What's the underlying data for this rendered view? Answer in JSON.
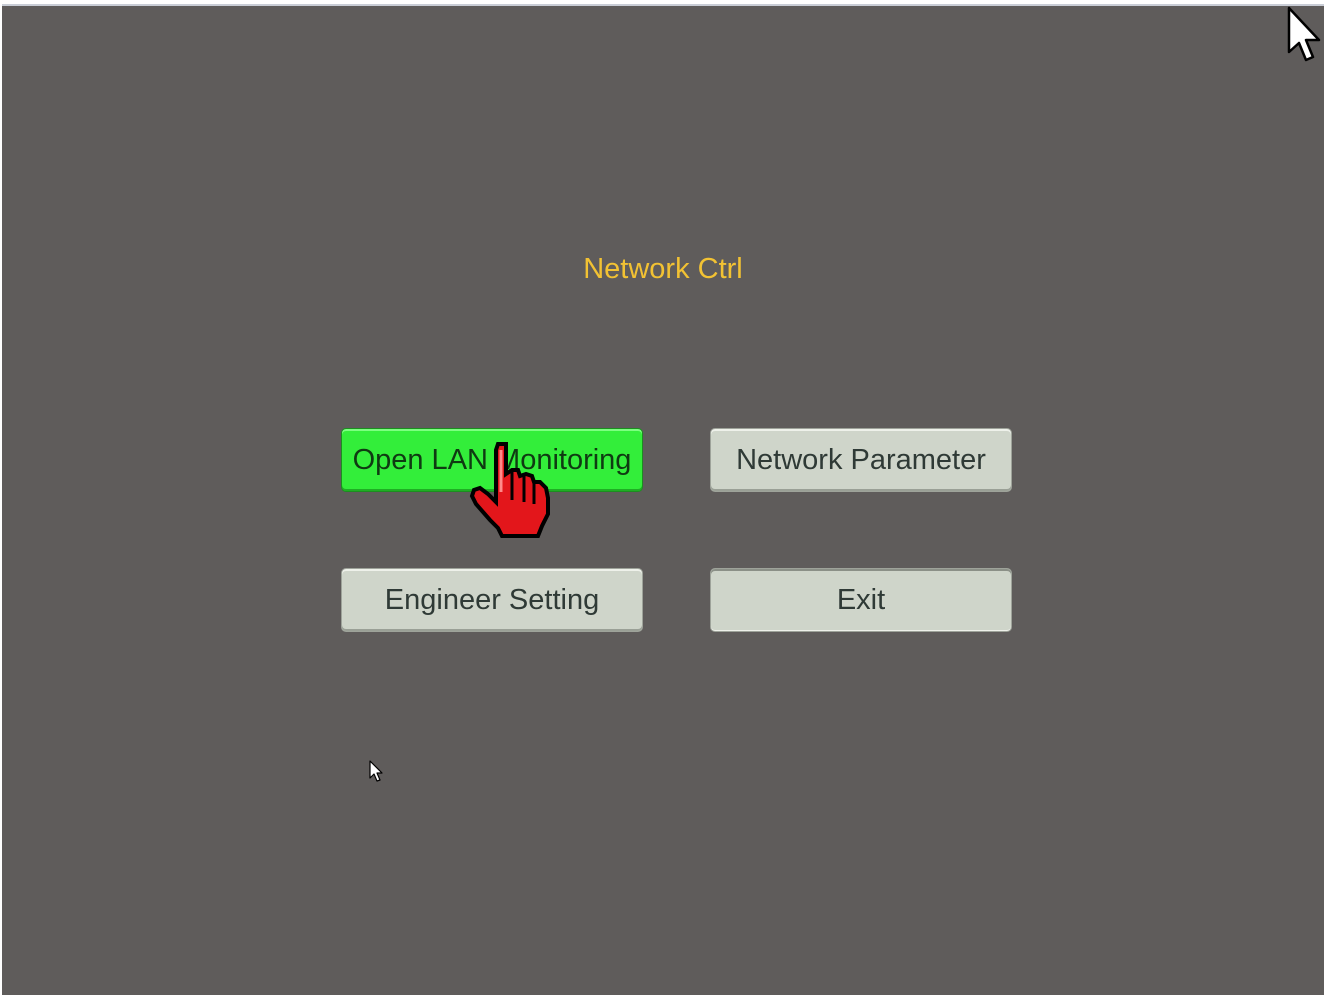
{
  "dialog": {
    "title": "Network Ctrl"
  },
  "buttons": {
    "open_lan_monitoring": "Open LAN Monitoring",
    "network_parameter": "Network Parameter",
    "engineer_setting": "Engineer Setting",
    "exit": "Exit"
  },
  "colors": {
    "background": "#5f5c5b",
    "title": "#f2c233",
    "button_default": "#cfd5ca",
    "button_active": "#33ee3a",
    "hand_cursor": "#e3161b"
  },
  "icons": {
    "large_cursor": "arrow-cursor-icon",
    "small_cursor": "arrow-cursor-icon",
    "hand_pointer": "pointing-hand-icon"
  }
}
